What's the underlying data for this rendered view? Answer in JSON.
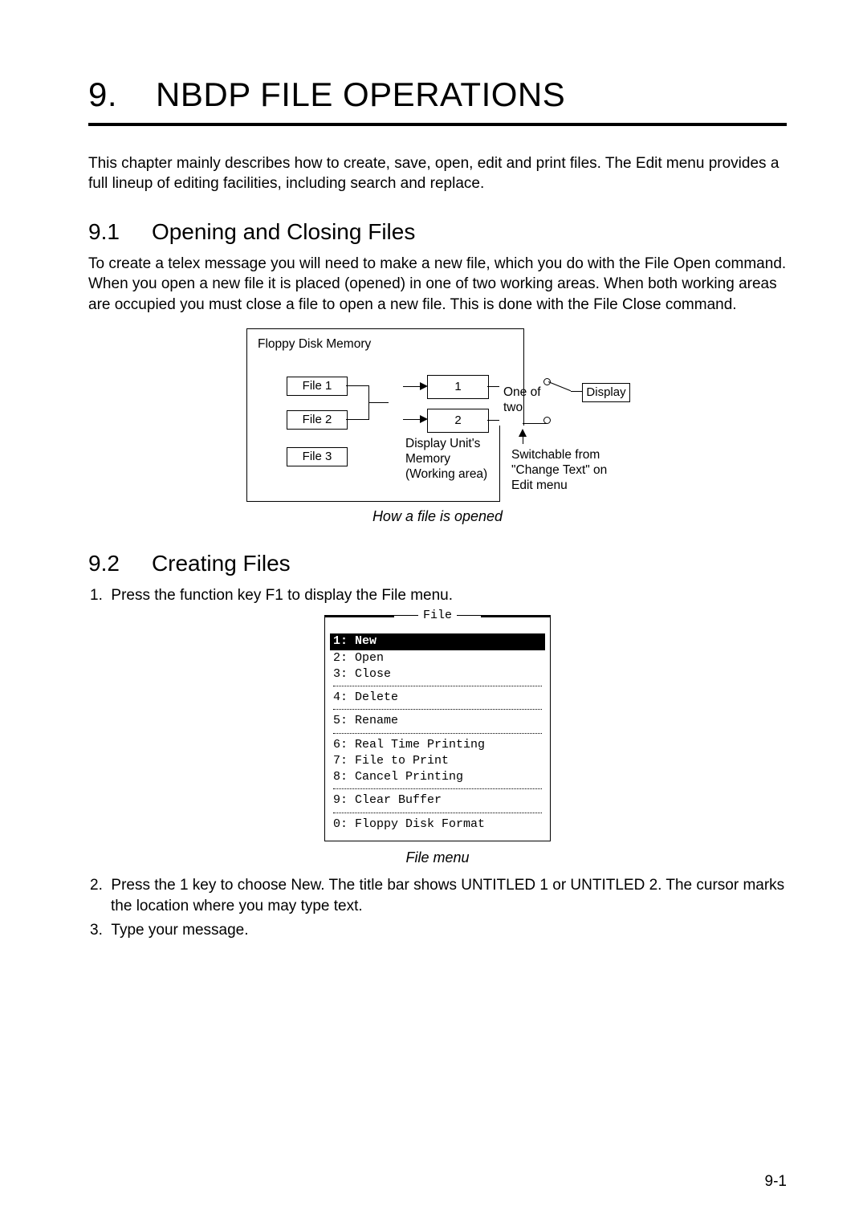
{
  "chapter": {
    "number": "9.",
    "title": "NBDP FILE OPERATIONS"
  },
  "intro": "This chapter mainly describes how to create, save, open, edit and print files. The Edit menu provides a full lineup of editing facilities, including search and replace.",
  "section91": {
    "number": "9.1",
    "title": "Opening and Closing Files",
    "body": "To create a telex message you will need to make a new file, which you do with the File Open command. When you open a new file it is placed (opened) in one of two working areas. When both working areas are occupied you must close a file to open a new file. This is done with the File Close command."
  },
  "diagram1": {
    "floppy_label": "Floppy Disk Memory",
    "file1": "File 1",
    "file2": "File 2",
    "file3": "File 3",
    "slot1": "1",
    "slot2": "2",
    "memory": "Display Unit's\nMemory\n(Working area)",
    "one_of_two": "One of\ntwo",
    "display": "Display",
    "switch": "Switchable from\n\"Change Text\" on\nEdit menu",
    "caption": "How a file is opened"
  },
  "section92": {
    "number": "9.2",
    "title": "Creating Files",
    "step1_num": "1.",
    "step1": "Press the function key F1 to display the File menu.",
    "step2_num": "2.",
    "step2": "Press the 1 key to choose New. The title bar shows UNTITLED 1 or UNTITLED 2. The cursor marks the location where you may type text.",
    "step3_num": "3.",
    "step3": "Type your message."
  },
  "file_menu": {
    "title": "File",
    "items": [
      {
        "key": "1:",
        "label": "New",
        "selected": true
      },
      {
        "key": "2:",
        "label": "Open"
      },
      {
        "key": "3:",
        "label": "Close"
      },
      {
        "sep": true
      },
      {
        "key": "4:",
        "label": "Delete"
      },
      {
        "sep": true
      },
      {
        "key": "5:",
        "label": "Rename"
      },
      {
        "sep": true
      },
      {
        "key": "6:",
        "label": "Real Time Printing"
      },
      {
        "key": "7:",
        "label": "File to Print"
      },
      {
        "key": "8:",
        "label": "Cancel Printing"
      },
      {
        "sep": true
      },
      {
        "key": "9:",
        "label": "Clear Buffer"
      },
      {
        "sep": true
      },
      {
        "key": "0:",
        "label": "Floppy Disk Format"
      }
    ],
    "caption": "File menu"
  },
  "page_number": "9-1"
}
